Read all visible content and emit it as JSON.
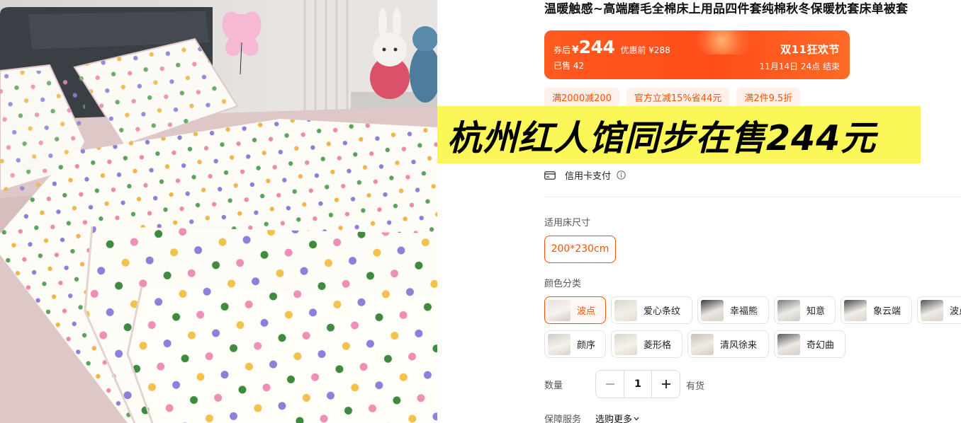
{
  "product": {
    "title": "温暖触感~高端磨毛全棉床上用品四件套纯棉秋冬保暖枕套床单被套"
  },
  "photo": {
    "pillow_tag": "butterfly"
  },
  "price_banner": {
    "after_coupon_label": "券后",
    "currency": "¥",
    "price": "244",
    "before_discount": "优惠前 ¥288",
    "sold": "已售 42",
    "festival": "双11狂欢节",
    "end_time": "11月14日 24点 结束"
  },
  "coupons": [
    "满2000减200",
    "官方立减15%省44元",
    "满2件9.5折"
  ],
  "overlay": {
    "text": "杭州红人馆同步在售244元"
  },
  "payment": {
    "label": "信用卡支付",
    "card_icon": "credit-card-icon",
    "info_icon": "info-circle-icon"
  },
  "size": {
    "label": "适用床尺寸",
    "options": [
      "200*230cm"
    ],
    "selected": "200*230cm"
  },
  "color": {
    "label": "颜色分类",
    "selected": "波点",
    "options": [
      "波点",
      "爱心条纹",
      "幸福熊",
      "知意",
      "象云端",
      "波点",
      "颜序",
      "菱形格",
      "清风徐来",
      "奇幻曲"
    ]
  },
  "quantity": {
    "label": "数量",
    "value": "1",
    "stock": "有货",
    "minus_icon": "minus-icon",
    "plus_icon": "plus-icon"
  },
  "service": {
    "label": "保障服务",
    "select": "选购更多"
  },
  "colors": {
    "accent": "#ff5000",
    "banner": "#ff5a1f",
    "coupon_bg": "#fff0eb",
    "overlay_bg": "#fcf759"
  }
}
